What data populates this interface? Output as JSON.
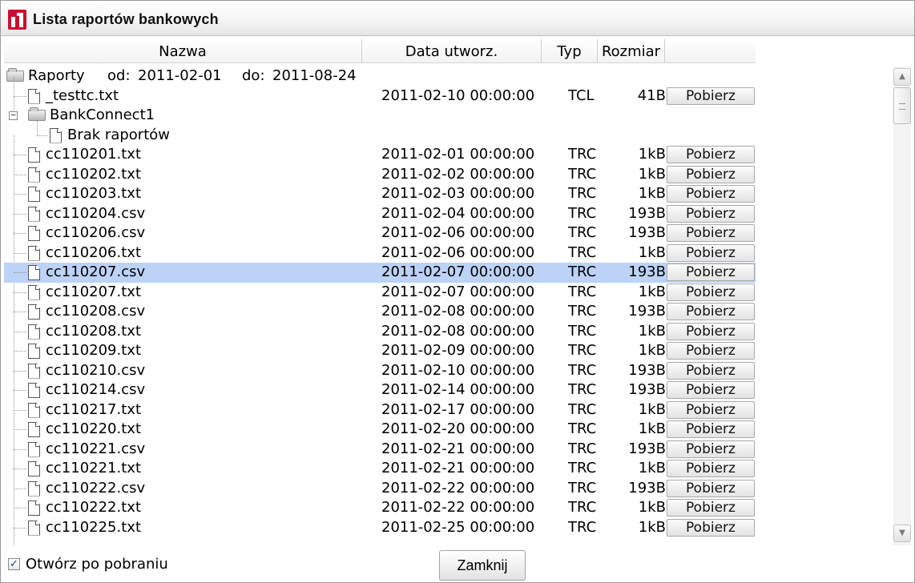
{
  "window": {
    "title": "Lista raportów bankowych",
    "brand_color": "#c8102e"
  },
  "columns": {
    "name": "Nazwa",
    "date": "Data utworz.",
    "type": "Typ",
    "size": "Rozmiar"
  },
  "root": {
    "label": "Raporty",
    "from_label": "od:",
    "from_value": "2011-02-01",
    "to_label": "do:",
    "to_value": "2011-08-24"
  },
  "top_file": {
    "name": "_testtc.txt",
    "date": "2011-02-10 00:00:00",
    "type": "TCL",
    "size": "41B",
    "button": "Pobierz"
  },
  "folder": {
    "label": "BankConnect1",
    "expander": "−",
    "empty_label": "Brak raportów"
  },
  "download_label": "Pobierz",
  "selected_index": 6,
  "files": [
    {
      "name": "cc110201.txt",
      "date": "2011-02-01 00:00:00",
      "type": "TRC",
      "size": "1kB"
    },
    {
      "name": "cc110202.txt",
      "date": "2011-02-02 00:00:00",
      "type": "TRC",
      "size": "1kB"
    },
    {
      "name": "cc110203.txt",
      "date": "2011-02-03 00:00:00",
      "type": "TRC",
      "size": "1kB"
    },
    {
      "name": "cc110204.csv",
      "date": "2011-02-04 00:00:00",
      "type": "TRC",
      "size": "193B"
    },
    {
      "name": "cc110206.csv",
      "date": "2011-02-06 00:00:00",
      "type": "TRC",
      "size": "193B"
    },
    {
      "name": "cc110206.txt",
      "date": "2011-02-06 00:00:00",
      "type": "TRC",
      "size": "1kB"
    },
    {
      "name": "cc110207.csv",
      "date": "2011-02-07 00:00:00",
      "type": "TRC",
      "size": "193B"
    },
    {
      "name": "cc110207.txt",
      "date": "2011-02-07 00:00:00",
      "type": "TRC",
      "size": "1kB"
    },
    {
      "name": "cc110208.csv",
      "date": "2011-02-08 00:00:00",
      "type": "TRC",
      "size": "193B"
    },
    {
      "name": "cc110208.txt",
      "date": "2011-02-08 00:00:00",
      "type": "TRC",
      "size": "1kB"
    },
    {
      "name": "cc110209.txt",
      "date": "2011-02-09 00:00:00",
      "type": "TRC",
      "size": "1kB"
    },
    {
      "name": "cc110210.csv",
      "date": "2011-02-10 00:00:00",
      "type": "TRC",
      "size": "193B"
    },
    {
      "name": "cc110214.csv",
      "date": "2011-02-14 00:00:00",
      "type": "TRC",
      "size": "193B"
    },
    {
      "name": "cc110217.txt",
      "date": "2011-02-17 00:00:00",
      "type": "TRC",
      "size": "1kB"
    },
    {
      "name": "cc110220.txt",
      "date": "2011-02-20 00:00:00",
      "type": "TRC",
      "size": "1kB"
    },
    {
      "name": "cc110221.csv",
      "date": "2011-02-21 00:00:00",
      "type": "TRC",
      "size": "193B"
    },
    {
      "name": "cc110221.txt",
      "date": "2011-02-21 00:00:00",
      "type": "TRC",
      "size": "1kB"
    },
    {
      "name": "cc110222.csv",
      "date": "2011-02-22 00:00:00",
      "type": "TRC",
      "size": "193B"
    },
    {
      "name": "cc110222.txt",
      "date": "2011-02-22 00:00:00",
      "type": "TRC",
      "size": "1kB"
    },
    {
      "name": "cc110225.txt",
      "date": "2011-02-25 00:00:00",
      "type": "TRC",
      "size": "1kB"
    }
  ],
  "footer": {
    "open_after_download_label": "Otwórz po pobraniu",
    "open_after_download_checked": "✓",
    "close_label": "Zamknij"
  },
  "icons": {
    "scroll_up": "▲",
    "scroll_down": "▼"
  }
}
